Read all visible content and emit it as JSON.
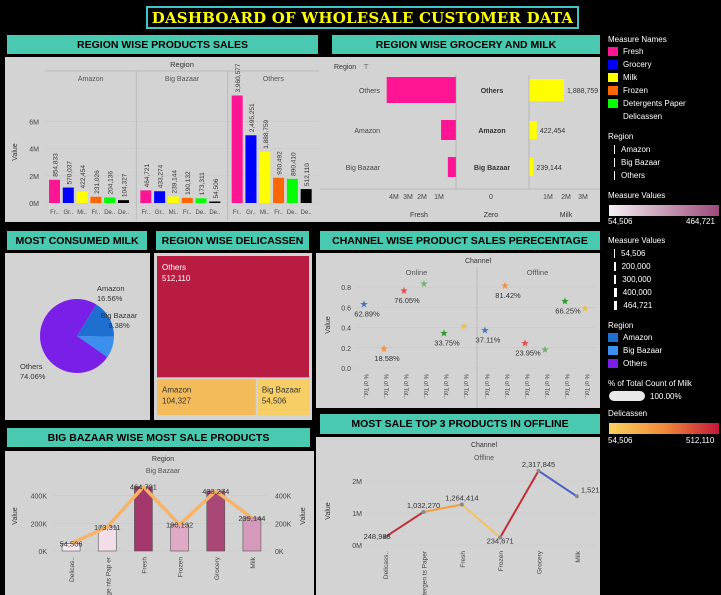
{
  "dashboard": {
    "title": "DASHBOARD OF WHOLESALE CUSTOMER DATA"
  },
  "headers": {
    "region_products": "REGION WISE PRODUCTS SALES",
    "region_grocery_milk": "REGION WISE GROCERY AND MILK",
    "most_milk": "MOST CONSUMED MILK",
    "region_delicassen": "REGION WISE DELICASSEN",
    "channel_pct": "CHANNEL WISE PRODUCT SALES PERECENTAGE",
    "bigbazaar": "BIG BAZAAR WISE MOST SALE PRODUCTS",
    "offline_top": "MOST SALE TOP 3 PRODUCTS IN OFFLINE"
  },
  "legend": {
    "measure_names_title": "Measure Names",
    "measure_names": [
      {
        "label": "Fresh",
        "color": "#ff1493"
      },
      {
        "label": "Grocery",
        "color": "#0000ff"
      },
      {
        "label": "Milk",
        "color": "#ffff00"
      },
      {
        "label": "Frozen",
        "color": "#ff6600"
      },
      {
        "label": "Detergents Paper",
        "color": "#00ff00"
      },
      {
        "label": "Delicassen",
        "color": "#000000"
      }
    ],
    "region_title": "Region",
    "regions_plain": [
      "Amazon",
      "Big Bazaar",
      "Others"
    ],
    "measure_values_title": "Measure Values",
    "measure_values_min": "54,506",
    "measure_values_max": "464,721",
    "measure_values_title2": "Measure Values",
    "size_items": [
      "54,506",
      "200,000",
      "300,000",
      "400,000",
      "464,721"
    ],
    "region_title2": "Region",
    "regions_colored": [
      {
        "label": "Amazon",
        "color": "#1f6fd1"
      },
      {
        "label": "Big Bazaar",
        "color": "#3a8fef"
      },
      {
        "label": "Others",
        "color": "#7a1fe8"
      }
    ],
    "pct_milk_title": "% of Total Count of Milk",
    "pct_milk_value": "100.00%",
    "delicassen_title": "Delicassen",
    "delicassen_min": "54,506",
    "delicassen_max": "512,110"
  },
  "chart_data": [
    {
      "id": "region_products",
      "type": "bar",
      "title": "REGION WISE PRODUCTS SALES",
      "column_header": "Region",
      "ylabel": "Value",
      "ylim": [
        0,
        4200000
      ],
      "yticks": [
        "0M",
        "2M",
        "4M",
        "6M"
      ],
      "ytick_values": [
        0,
        1000000,
        2000000,
        3000000
      ],
      "groups": [
        "Amazon",
        "Big Bazaar",
        "Others"
      ],
      "categories": [
        "Fr..",
        "Gr..",
        "Mi..",
        "Fr..",
        "De..",
        "De.."
      ],
      "series": [
        {
          "group": "Amazon",
          "values": [
            854833,
            570037,
            422454,
            231026,
            204136,
            104327
          ],
          "labels": [
            "854,833",
            "570,037",
            "422,454",
            "231,026",
            "204,136",
            "104,327"
          ]
        },
        {
          "group": "Big Bazaar",
          "values": [
            464721,
            433274,
            239144,
            190132,
            173311,
            54506
          ],
          "labels": [
            "464,721",
            "433,274",
            "239,144",
            "190,132",
            "173,311",
            "54,506"
          ]
        },
        {
          "group": "Others",
          "values": [
            3960577,
            2495251,
            1888759,
            930492,
            890410,
            512110
          ],
          "labels": [
            "3,960,577",
            "2,495,251",
            "1,888,759",
            "930,492",
            "890,410",
            "512,110"
          ]
        }
      ]
    },
    {
      "id": "region_grocery_milk",
      "type": "bar",
      "title": "REGION WISE GROCERY AND MILK",
      "filter_label": "Region",
      "regions": [
        "Others",
        "Amazon",
        "Big Bazaar"
      ],
      "fresh": [
        3960577,
        854833,
        464721
      ],
      "grocery": [
        2495251,
        570037,
        433274
      ],
      "milk": [
        1888759,
        422454,
        239144
      ],
      "milk_labels": [
        "1,888,759",
        "422,454",
        "239,144"
      ],
      "fresh_ticks": [
        "4M",
        "3M",
        "2M",
        "1M"
      ],
      "zero_ticks": [
        "0"
      ],
      "milk_ticks": [
        "1M",
        "2M",
        "3M"
      ],
      "axis_titles": [
        "Fresh",
        "Zero",
        "Milk"
      ]
    },
    {
      "id": "most_milk",
      "type": "pie",
      "title": "MOST CONSUMED MILK",
      "slices": [
        {
          "label": "Amazon",
          "value": 16.56,
          "text": "16.56%"
        },
        {
          "label": "Big Bazaar",
          "value": 9.38,
          "text": "9.38%"
        },
        {
          "label": "Others",
          "value": 74.06,
          "text": "74.06%"
        }
      ]
    },
    {
      "id": "region_delicassen",
      "type": "heatmap",
      "title": "REGION WISE DELICASSEN",
      "cells": [
        {
          "label": "Others",
          "value": 512110,
          "text": "512,110"
        },
        {
          "label": "Amazon",
          "value": 104327,
          "text": "104,327"
        },
        {
          "label": "Big Bazaar",
          "value": 54506,
          "text": "54,506"
        }
      ]
    },
    {
      "id": "channel_pct",
      "type": "scatter",
      "title": "CHANNEL WISE PRODUCT SALES PERECENTAGE",
      "column_header": "Channel",
      "ylabel": "Value",
      "ylim": [
        0,
        0.9
      ],
      "yticks": [
        "0.0",
        "0.2",
        "0.4",
        "0.6",
        "0.8"
      ],
      "ytick_values": [
        0.0,
        0.2,
        0.4,
        0.6,
        0.8
      ],
      "channels": [
        "Online",
        "Offline"
      ],
      "xtick_label": "% of Tot..",
      "points": [
        {
          "channel": "Online",
          "x": 0,
          "y": 0.63,
          "color": "#4a73c4",
          "label": "62.89%"
        },
        {
          "channel": "Online",
          "x": 1,
          "y": 0.19,
          "color": "#ff8c3a",
          "label": "18.58%"
        },
        {
          "channel": "Online",
          "x": 2,
          "y": 0.76,
          "color": "#e84a4a",
          "label": "76.05%"
        },
        {
          "channel": "Online",
          "x": 3,
          "y": 0.83,
          "color": "#70b070",
          "label": ""
        },
        {
          "channel": "Online",
          "x": 4,
          "y": 0.34,
          "color": "#2e9a2e",
          "label": "33.75%"
        },
        {
          "channel": "Online",
          "x": 5,
          "y": 0.41,
          "color": "#f0c030",
          "label": ""
        },
        {
          "channel": "Offline",
          "x": 0,
          "y": 0.37,
          "color": "#4a73c4",
          "label": "37.11%"
        },
        {
          "channel": "Offline",
          "x": 1,
          "y": 0.81,
          "color": "#ff8c3a",
          "label": "81.42%"
        },
        {
          "channel": "Offline",
          "x": 2,
          "y": 0.24,
          "color": "#e84a4a",
          "label": "23.95%"
        },
        {
          "channel": "Offline",
          "x": 3,
          "y": 0.18,
          "color": "#70b070",
          "label": ""
        },
        {
          "channel": "Offline",
          "x": 4,
          "y": 0.66,
          "color": "#2e9a2e",
          "label": "66.25%"
        },
        {
          "channel": "Offline",
          "x": 5,
          "y": 0.59,
          "color": "#f0c030",
          "label": ""
        }
      ]
    },
    {
      "id": "bigbazaar",
      "type": "bar",
      "title": "BIG BAZAAR WISE MOST SALE PRODUCTS",
      "column_header": "Region",
      "group": "Big Bazaar",
      "ylabel": "Value",
      "ylim": [
        0,
        520000
      ],
      "yticks": [
        "0K",
        "200K",
        "400K"
      ],
      "ytick_values": [
        0,
        200000,
        400000
      ],
      "categories": [
        "Delicas..",
        "Deterge nts Pap er",
        "Fresh",
        "Frozen",
        "Grocery",
        "Milk"
      ],
      "values": [
        54506,
        173311,
        464721,
        190132,
        433274,
        239144
      ],
      "labels": [
        "54,506",
        "173,311",
        "464,721",
        "190,132",
        "433,274",
        "239,144"
      ]
    },
    {
      "id": "offline_top",
      "type": "line",
      "title": "MOST SALE TOP 3 PRODUCTS IN OFFLINE",
      "column_header": "Channel",
      "channel": "Offline",
      "ylabel": "Value",
      "ylim": [
        0,
        2500000
      ],
      "yticks": [
        "0M",
        "1M",
        "2M"
      ],
      "ytick_values": [
        0,
        1000000,
        2000000
      ],
      "categories": [
        "Delicass..",
        "Detergen ts Paper",
        "Fresh",
        "Frozen",
        "Grocery",
        "Milk"
      ],
      "values": [
        248988,
        1032270,
        1264414,
        234671,
        2317845,
        1521743
      ],
      "labels": [
        "248,988",
        "1,032,270",
        "1,264,414",
        "234,671",
        "2,317,845",
        "1,521,743"
      ]
    }
  ]
}
